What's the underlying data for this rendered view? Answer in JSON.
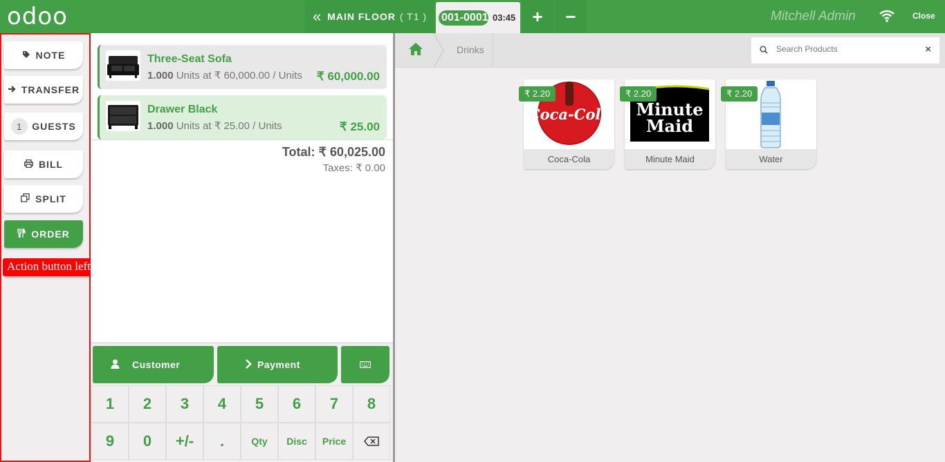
{
  "header": {
    "logo": "odoo",
    "floor_label": "MAIN FLOOR",
    "table_label": "( T1 )",
    "order_number": "001-0001",
    "order_time": "03:45",
    "add_label": "+",
    "remove_label": "−",
    "user": "Mitchell Admin",
    "close_label": "Close"
  },
  "actions": {
    "note": "NOTE",
    "transfer": "TRANSFER",
    "guests_count": "1",
    "guests": "GUESTS",
    "bill": "BILL",
    "split": "SPLIT",
    "order": "ORDER"
  },
  "annotation": "Action button left side",
  "order_lines": [
    {
      "name": "Three-Seat Sofa",
      "qty": "1.000",
      "info": "Units at ₹ 60,000.00 / Units",
      "price": "₹ 60,000.00"
    },
    {
      "name": "Drawer Black",
      "qty": "1.000",
      "info": "Units at ₹ 25.00 / Units",
      "price": "₹ 25.00"
    }
  ],
  "summary": {
    "total": "Total: ₹ 60,025.00",
    "taxes": "Taxes: ₹ 0.00"
  },
  "control": {
    "customer": "Customer",
    "payment": "Payment"
  },
  "numpad": {
    "k1": "1",
    "k2": "2",
    "k3": "3",
    "k4": "4",
    "k5": "5",
    "k6": "6",
    "k7": "7",
    "k8": "8",
    "k9": "9",
    "k0": "0",
    "kpm": "+/-",
    "kdot": ".",
    "qty": "Qty",
    "disc": "Disc",
    "price": "Price"
  },
  "breadcrumb": {
    "category": "Drinks"
  },
  "search": {
    "placeholder": "Search Products",
    "clear": "×"
  },
  "products": [
    {
      "name": "Coca-Cola",
      "price": "₹ 2.20"
    },
    {
      "name": "Minute Maid",
      "price": "₹ 2.20"
    },
    {
      "name": "Water",
      "price": "₹ 2.20"
    }
  ],
  "colors": {
    "accent": "#43a047",
    "annotation": "#ff0000"
  }
}
